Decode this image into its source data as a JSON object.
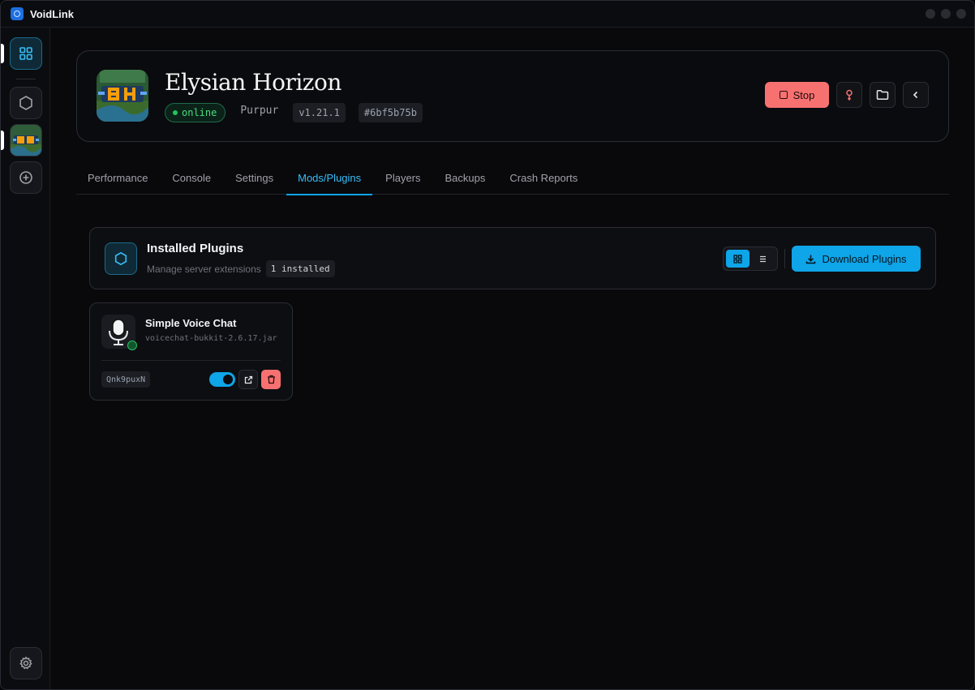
{
  "app": {
    "title": "VoidLink"
  },
  "sidebar": {
    "items": [
      {
        "name": "dashboard",
        "icon": "grid-icon",
        "active": true
      },
      {
        "name": "servers-placeholder",
        "icon": "hexagon-icon"
      },
      {
        "name": "server-elysian-horizon",
        "icon": "server-thumbnail",
        "active": true
      },
      {
        "name": "add-server",
        "icon": "plus-circle-icon"
      },
      {
        "name": "settings",
        "icon": "gear-icon"
      }
    ]
  },
  "server": {
    "name": "Elysian Horizon",
    "status": "online",
    "type": "Purpur",
    "version": "v1.21.1",
    "id": "#6bf5b75b",
    "stop_label": "Stop"
  },
  "tabs": [
    {
      "label": "Performance"
    },
    {
      "label": "Console"
    },
    {
      "label": "Settings"
    },
    {
      "label": "Mods/Plugins",
      "active": true
    },
    {
      "label": "Players"
    },
    {
      "label": "Backups"
    },
    {
      "label": "Crash Reports"
    }
  ],
  "plugins": {
    "title": "Installed Plugins",
    "subtitle": "Manage server extensions",
    "count_label": "1 installed",
    "download_label": "Download Plugins",
    "view_mode": "grid",
    "items": [
      {
        "name": "Simple Voice Chat",
        "file": "voicechat-bukkit-2.6.17.jar",
        "id": "Qnk9puxN",
        "enabled": true
      }
    ]
  },
  "colors": {
    "accent": "#0ea5e9",
    "danger": "#f87171",
    "online": "#22c55e"
  }
}
